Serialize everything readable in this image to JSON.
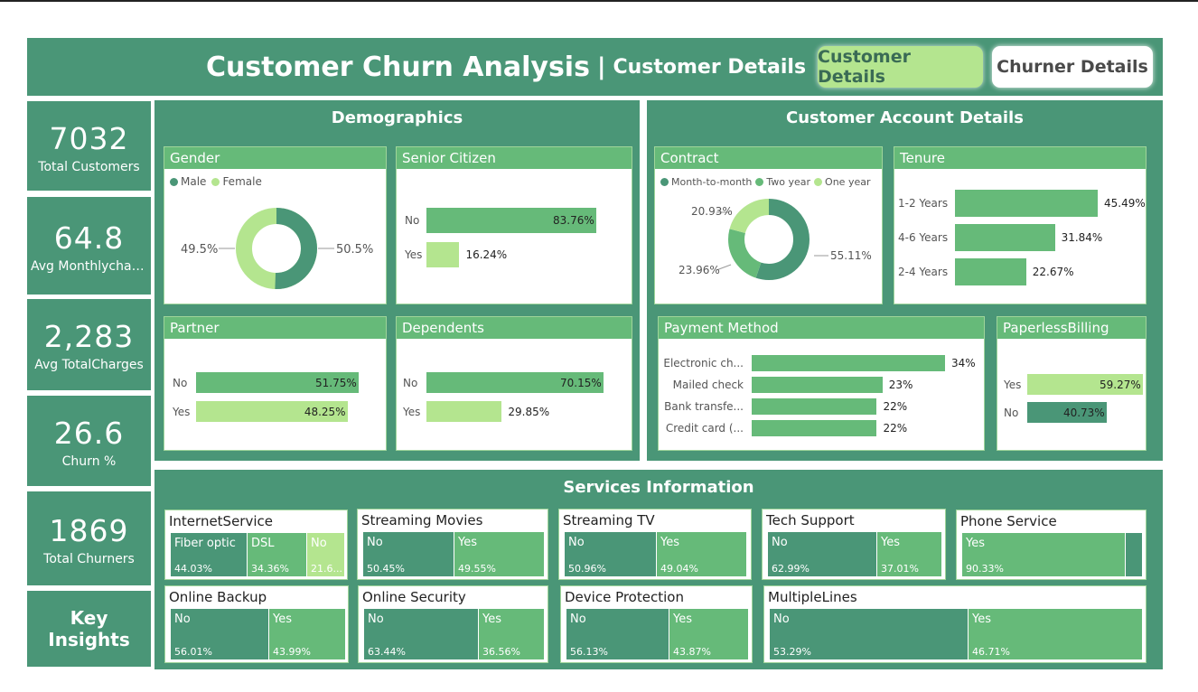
{
  "header": {
    "title": "Customer Churn Analysis",
    "separator": "|",
    "subtitle": "Customer Details",
    "nav": {
      "active": "Customer Details",
      "inactive": "Churner Details"
    }
  },
  "kpis": [
    {
      "value": "7032",
      "label": "Total Customers"
    },
    {
      "value": "64.8",
      "label": "Avg Monthlychar..."
    },
    {
      "value": "2,283",
      "label": "Avg TotalCharges"
    },
    {
      "value": "26.6",
      "label": "Churn %"
    },
    {
      "value": "1869",
      "label": "Total Churners"
    }
  ],
  "key_insights": "Key Insights",
  "colors": {
    "dark": "#4a9677",
    "mid": "#66ba79",
    "light": "#b4e58f"
  },
  "demographics": {
    "title": "Demographics",
    "gender": {
      "title": "Gender",
      "legend": [
        "Male",
        "Female"
      ],
      "male_pct": 50.5,
      "female_pct": 49.5,
      "male_label": "50.5%",
      "female_label": "49.5%"
    },
    "senior": {
      "title": "Senior Citizen",
      "rows": [
        {
          "label": "No",
          "value": 83.76,
          "text": "83.76%"
        },
        {
          "label": "Yes",
          "value": 16.24,
          "text": "16.24%"
        }
      ]
    },
    "partner": {
      "title": "Partner",
      "rows": [
        {
          "label": "No",
          "value": 51.75,
          "text": "51.75%"
        },
        {
          "label": "Yes",
          "value": 48.25,
          "text": "48.25%"
        }
      ]
    },
    "dependents": {
      "title": "Dependents",
      "rows": [
        {
          "label": "No",
          "value": 70.15,
          "text": "70.15%"
        },
        {
          "label": "Yes",
          "value": 29.85,
          "text": "29.85%"
        }
      ]
    }
  },
  "account": {
    "title": "Customer Account Details",
    "contract": {
      "title": "Contract",
      "legend": [
        "Month-to-month",
        "Two year",
        "One year"
      ],
      "values": [
        55.11,
        23.96,
        20.93
      ],
      "labels": [
        "55.11%",
        "23.96%",
        "20.93%"
      ]
    },
    "tenure": {
      "title": "Tenure",
      "rows": [
        {
          "label": "1-2 Years",
          "value": 45.49,
          "text": "45.49%"
        },
        {
          "label": "4-6 Years",
          "value": 31.84,
          "text": "31.84%"
        },
        {
          "label": "2-4 Years",
          "value": 22.67,
          "text": "22.67%"
        }
      ]
    },
    "payment": {
      "title": "Payment Method",
      "rows": [
        {
          "label": "Electronic ch...",
          "value": 34,
          "text": "34%"
        },
        {
          "label": "Mailed check",
          "value": 23,
          "text": "23%"
        },
        {
          "label": "Bank transfe...",
          "value": 22,
          "text": "22%"
        },
        {
          "label": "Credit card (...",
          "value": 22,
          "text": "22%"
        }
      ]
    },
    "paperless": {
      "title": "PaperlessBilling",
      "rows": [
        {
          "label": "Yes",
          "value": 59.27,
          "text": "59.27%"
        },
        {
          "label": "No",
          "value": 40.73,
          "text": "40.73%"
        }
      ]
    }
  },
  "services": {
    "title": "Services Information",
    "internet": {
      "title": "InternetService",
      "tiles": [
        {
          "label": "Fiber optic",
          "text": "44.03%"
        },
        {
          "label": "DSL",
          "text": "34.36%"
        },
        {
          "label": "No",
          "text": "21.6..."
        }
      ]
    },
    "streaming_movies": {
      "title": "Streaming Movies",
      "tiles": [
        {
          "label": "No",
          "text": "50.45%"
        },
        {
          "label": "Yes",
          "text": "49.55%"
        }
      ]
    },
    "streaming_tv": {
      "title": "Streaming TV",
      "tiles": [
        {
          "label": "No",
          "text": "50.96%"
        },
        {
          "label": "Yes",
          "text": "49.04%"
        }
      ]
    },
    "tech_support": {
      "title": "Tech Support",
      "tiles": [
        {
          "label": "No",
          "text": "62.99%"
        },
        {
          "label": "Yes",
          "text": "37.01%"
        }
      ]
    },
    "phone_service": {
      "title": "Phone Service",
      "tiles": [
        {
          "label": "Yes",
          "text": "90.33%"
        }
      ]
    },
    "online_backup": {
      "title": "Online Backup",
      "tiles": [
        {
          "label": "No",
          "text": "56.01%"
        },
        {
          "label": "Yes",
          "text": "43.99%"
        }
      ]
    },
    "online_security": {
      "title": "Online Security",
      "tiles": [
        {
          "label": "No",
          "text": "63.44%"
        },
        {
          "label": "Yes",
          "text": "36.56%"
        }
      ]
    },
    "device_protection": {
      "title": "Device Protection",
      "tiles": [
        {
          "label": "No",
          "text": "56.13%"
        },
        {
          "label": "Yes",
          "text": "43.87%"
        }
      ]
    },
    "multiple_lines": {
      "title": "MultipleLines",
      "tiles": [
        {
          "label": "No",
          "text": "53.29%"
        },
        {
          "label": "Yes",
          "text": "46.71%"
        }
      ]
    }
  }
}
